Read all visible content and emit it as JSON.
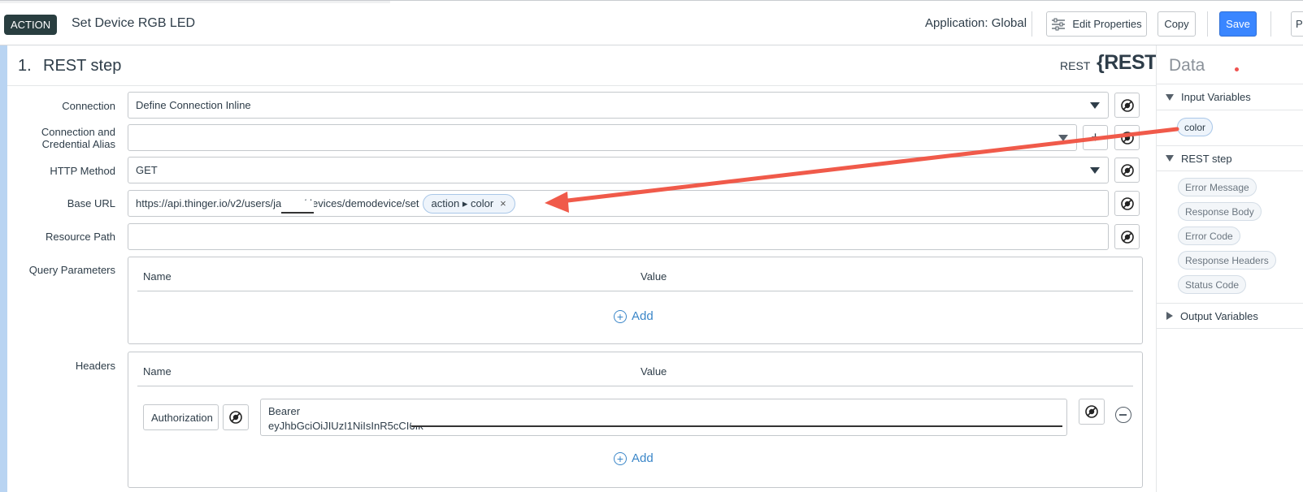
{
  "header": {
    "badge": "ACTION",
    "title": "Set Device RGB LED",
    "application": "Application: Global",
    "edit_properties": "Edit Properties",
    "copy": "Copy",
    "save": "Save",
    "edge_button": "P"
  },
  "step": {
    "number": "1.",
    "name": "REST step",
    "type": "REST",
    "logo": "{REST}"
  },
  "form": {
    "connection_label": "Connection",
    "connection_value": "Define Connection Inline",
    "alias_label": "Connection and Credential Alias",
    "alias_value": "",
    "alias_add": "+",
    "method_label": "HTTP Method",
    "method_value": "GET",
    "base_url_label": "Base URL",
    "base_url_prefix": "https://api.thinger.io/v2/users/jas",
    "base_url_suffix": "ee/devices/demodevice/set",
    "base_url_chip": "action ▸ color",
    "chip_remove": "×",
    "resource_path_label": "Resource Path",
    "resource_path_value": "",
    "query_label": "Query Parameters",
    "headers_label": "Headers"
  },
  "query_table": {
    "col_name": "Name",
    "col_value": "Value",
    "add": "Add"
  },
  "headers_table": {
    "col_name": "Name",
    "col_value": "Value",
    "row_name": "Authorization",
    "row_value_line1": "Bearer",
    "row_value_line2": "eyJhbGciOiJIUzI1NiIsInR5cCI6Ik",
    "add": "Add"
  },
  "data_panel": {
    "title": "Data",
    "input_variables": "Input Variables",
    "input_pills": [
      "color"
    ],
    "rest_step": "REST step",
    "rest_pills": [
      "Error Message",
      "Response Body",
      "Error Code",
      "Response Headers",
      "Status Code"
    ],
    "output_variables": "Output Variables"
  },
  "colors": {
    "primary": "#3a86ff",
    "badge_bg": "#293e40",
    "arrow": "#f05a4a",
    "link": "#3a86c8"
  }
}
